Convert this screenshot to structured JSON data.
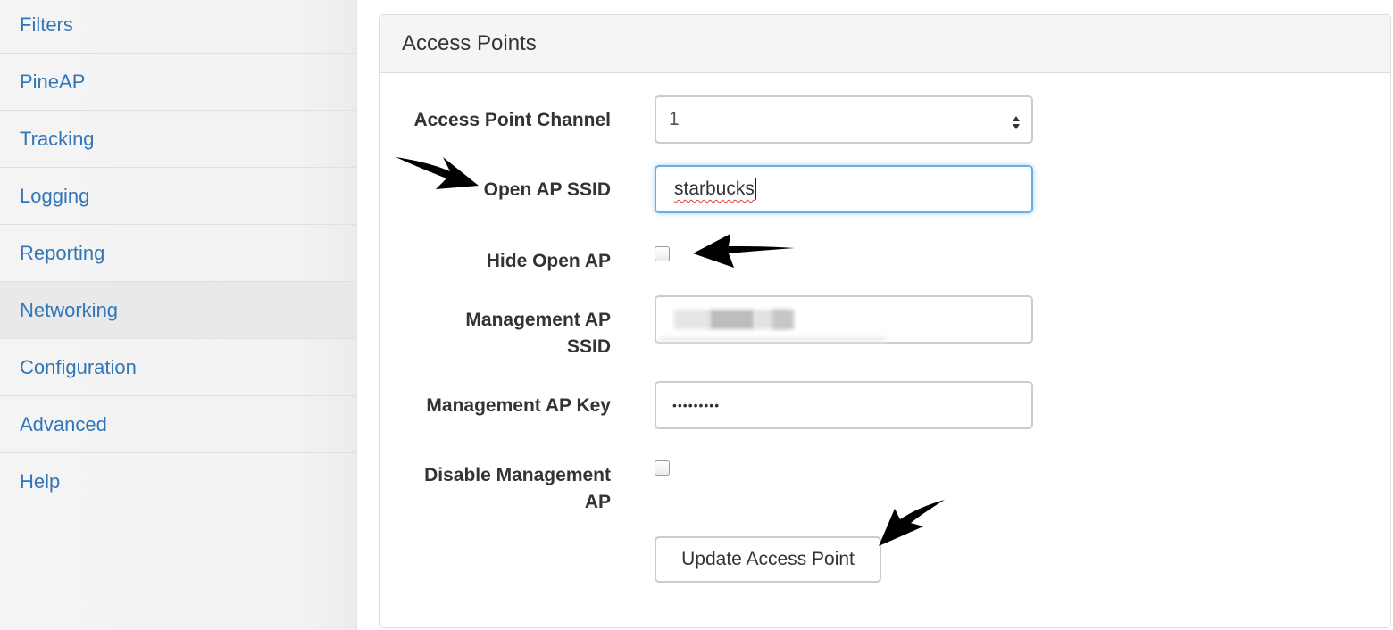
{
  "sidebar": {
    "items": [
      {
        "label": "Filters"
      },
      {
        "label": "PineAP"
      },
      {
        "label": "Tracking"
      },
      {
        "label": "Logging"
      },
      {
        "label": "Reporting"
      },
      {
        "label": "Networking",
        "active": true
      },
      {
        "label": "Configuration"
      },
      {
        "label": "Advanced"
      },
      {
        "label": "Help"
      }
    ]
  },
  "panel": {
    "title": "Access Points",
    "fields": {
      "channel": {
        "label": "Access Point Channel",
        "value": "1"
      },
      "open_ssid": {
        "label": "Open AP SSID",
        "value": "starbucks"
      },
      "hide_open": {
        "label": "Hide Open AP",
        "checked": false
      },
      "mgmt_ssid": {
        "label_line1": "Management AP",
        "label_line2": "SSID",
        "value": ""
      },
      "mgmt_key": {
        "label": "Management AP Key",
        "masked_value": "•••••••••"
      },
      "disable_mgmt": {
        "label_line1": "Disable Management",
        "label_line2": "AP",
        "checked": false
      }
    },
    "update_button": "Update Access Point"
  },
  "colors": {
    "link": "#3276b8",
    "focus_border": "#66afe9",
    "annotation_arrow": "#000000"
  },
  "icons": [
    "select-chevron-icon",
    "annotation-arrow-icon"
  ]
}
